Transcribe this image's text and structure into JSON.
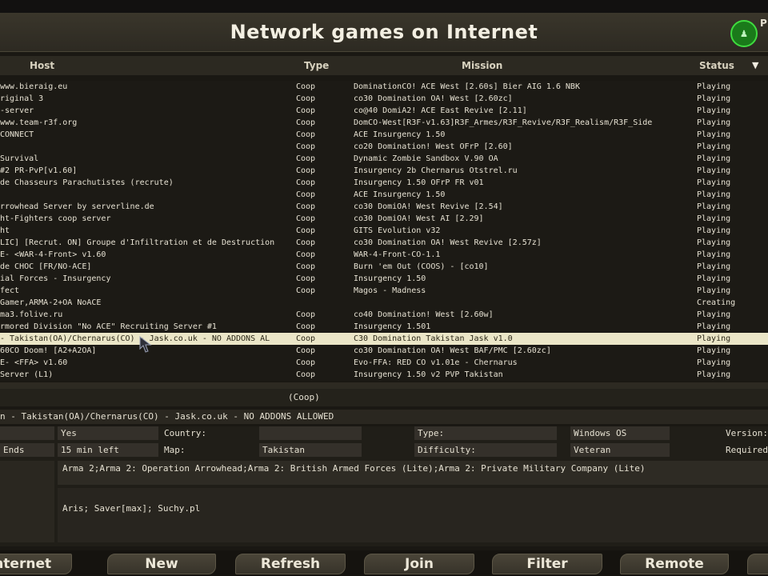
{
  "title": "Network games on Internet",
  "badge_text": "P",
  "columns": {
    "host": "Host",
    "type": "Type",
    "mission": "Mission",
    "status": "Status"
  },
  "sort_indicator": "▼",
  "servers": [
    {
      "host": "www.bieraig.eu",
      "type": "Coop",
      "mission": "DominationCO! ACE West [2.60s] Bier AIG 1.6 NBK",
      "status": "Playing"
    },
    {
      "host": "riginal 3",
      "type": "Coop",
      "mission": "co30 Domination OA! West [2.60zc]",
      "status": "Playing"
    },
    {
      "host": "-server",
      "type": "Coop",
      "mission": "co@40 DomiA2! ACE East Revive [2.11]",
      "status": "Playing"
    },
    {
      "host": "www.team-r3f.org",
      "type": "Coop",
      "mission": "DomCO-West[R3F-v1.63]R3F_Armes/R3F_Revive/R3F_Realism/R3F_Side",
      "status": "Playing"
    },
    {
      "host": "CONNECT",
      "type": "Coop",
      "mission": "ACE Insurgency 1.50",
      "status": "Playing"
    },
    {
      "host": "",
      "type": "Coop",
      "mission": "co20 Domination! West OFrP [2.60]",
      "status": "Playing"
    },
    {
      "host": "Survival",
      "type": "Coop",
      "mission": "Dynamic Zombie Sandbox V.90 OA",
      "status": "Playing"
    },
    {
      "host": "#2 PR-PvP[v1.60]",
      "type": "Coop",
      "mission": "Insurgency 2b Chernarus Otstrel.ru",
      "status": "Playing"
    },
    {
      "host": "de Chasseurs Parachutistes (recrute)",
      "type": "Coop",
      "mission": "Insurgency 1.50 OFrP FR v01",
      "status": "Playing"
    },
    {
      "host": "",
      "type": "Coop",
      "mission": "ACE Insurgency 1.50",
      "status": "Playing"
    },
    {
      "host": "rrowhead Server by serverline.de",
      "type": "Coop",
      "mission": "co30 DomiOA! West Revive [2.54]",
      "status": "Playing"
    },
    {
      "host": "ht-Fighters coop server",
      "type": "Coop",
      "mission": "co30 DomiOA! West AI [2.29]",
      "status": "Playing"
    },
    {
      "host": "ht",
      "type": "Coop",
      "mission": "GITS Evolution v32",
      "status": "Playing"
    },
    {
      "host": "LIC] [Recrut. ON] Groupe d'Infiltration et de Destruction",
      "type": "Coop",
      "mission": "co30 Domination OA! West Revive [2.57z]",
      "status": "Playing"
    },
    {
      "host": "E- <WAR-4-Front> v1.60",
      "type": "Coop",
      "mission": "WAR-4-Front-CO-1.1",
      "status": "Playing"
    },
    {
      "host": "de CHOC [FR/NO-ACE]",
      "type": "Coop",
      "mission": "Burn 'em Out (COOS) - [co10]",
      "status": "Playing"
    },
    {
      "host": "ial Forces - Insurgency",
      "type": "Coop",
      "mission": "Insurgency 1.50",
      "status": "Playing"
    },
    {
      "host": "fect",
      "type": "Coop",
      "mission": "Magos - Madness",
      "status": "Playing"
    },
    {
      "host": "Gamer,ARMA-2+OA NoACE",
      "type": "",
      "mission": "",
      "status": "Creating"
    },
    {
      "host": "ma3.folive.ru",
      "type": "Coop",
      "mission": "co40 Domination! West [2.60w]",
      "status": "Playing"
    },
    {
      "host": "rmored Division \"No ACE\" Recruiting Server #1",
      "type": "Coop",
      "mission": "Insurgency 1.501",
      "status": "Playing"
    },
    {
      "host": "- Takistan(OA)/Chernarus(CO) - Jask.co.uk - NO ADDONS AL",
      "type": "Coop",
      "mission": "C30 Domination Takistan Jask v1.0",
      "status": "Playing"
    },
    {
      "host": "60CO Doom! [A2+A2OA]",
      "type": "Coop",
      "mission": "co30 Domination OA! West BAF/PMC [2.60zc]",
      "status": "Playing"
    },
    {
      "host": "E- <FFA> v1.60",
      "type": "Coop",
      "mission": "Evo-FFA: RED CO v1.01e - Chernarus",
      "status": "Playing"
    },
    {
      "host": "Server (L1)",
      "type": "Coop",
      "mission": "Insurgency 1.50 v2 PVP Takistan",
      "status": "Playing"
    }
  ],
  "selected_index": 21,
  "summary_type": "(Coop)",
  "selected_server_name": "n - Takistan(OA)/Chernarus(CO) - Jask.co.uk - NO ADDONS ALLOWED",
  "details": {
    "row1": {
      "a": "Yes",
      "country_label": "Country:",
      "country_value": "",
      "type_label": "Type:",
      "type_value": "Windows OS",
      "version_label": "Version:"
    },
    "row2": {
      "left": "Ends",
      "a": "15 min left",
      "map_label": "Map:",
      "map_value": "Takistan",
      "difficulty_label": "Difficulty:",
      "difficulty_value": "Veteran",
      "required_label": "Required"
    },
    "mods": "Arma 2;Arma 2: Operation Arrowhead;Arma 2: British Armed Forces (Lite);Arma 2: Private Military Company (Lite)",
    "players": "Aris; Saver[max]; Suchy.pl"
  },
  "buttons": [
    "Internet",
    "New",
    "Refresh",
    "Join",
    "Filter",
    "Remote",
    ""
  ]
}
